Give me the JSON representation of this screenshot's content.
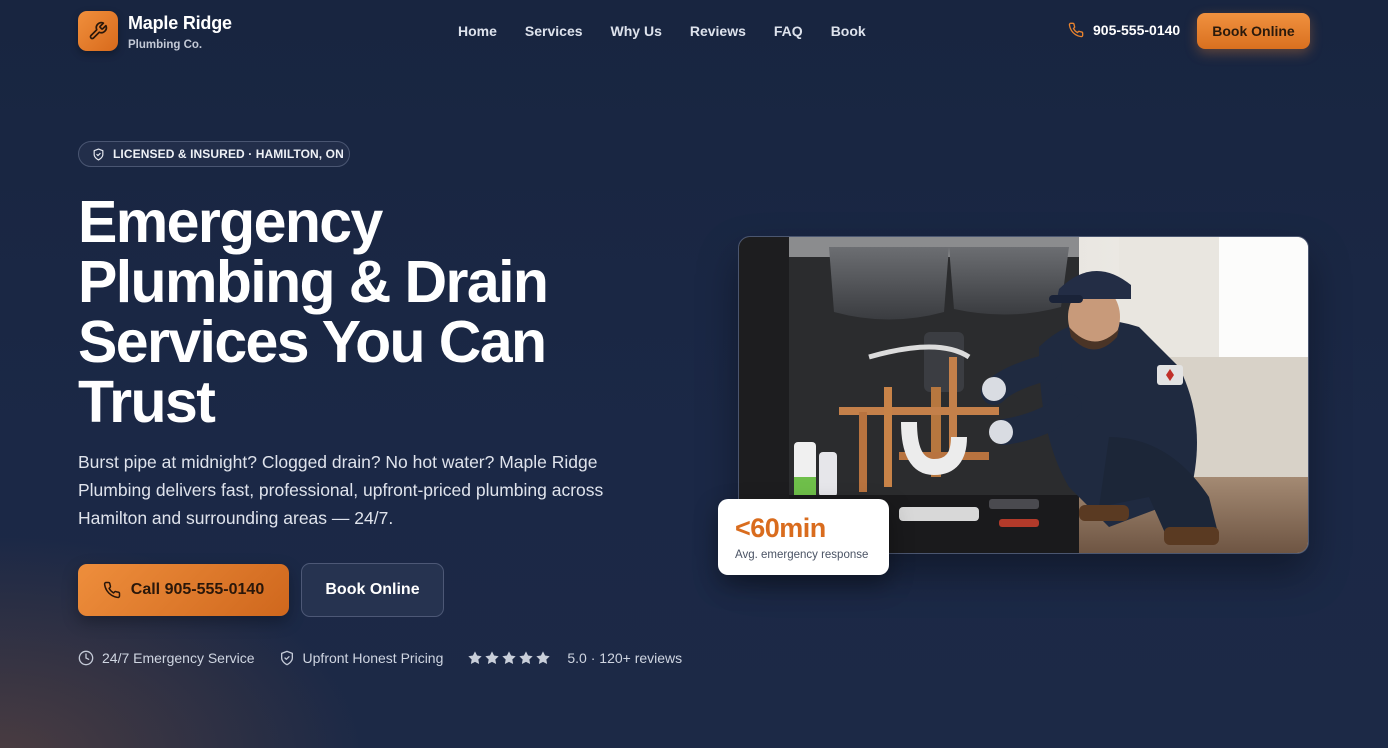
{
  "brand": {
    "name": "Maple Ridge",
    "subtitle": "Plumbing Co.",
    "icon": "wrench-icon",
    "accent": "#e8832e"
  },
  "nav": {
    "links": [
      "Home",
      "Services",
      "Why Us",
      "Reviews",
      "FAQ",
      "Book"
    ],
    "phone": "905-555-0140",
    "cta": "Book Online"
  },
  "hero": {
    "badge": "LICENSED & INSURED · HAMILTON, ON",
    "headline": "Emergency Plumbing & Drain Services You Can Trust",
    "subtext": "Burst pipe at midnight? Clogged drain? No hot water? Maple Ridge Plumbing delivers fast, professional, upfront-priced plumbing across Hamilton and surrounding areas — 24/7.",
    "call_button": "Call 905-555-0140",
    "book_button": "Book Online"
  },
  "trust": {
    "emergency": "24/7 Emergency Service",
    "pricing": "Upfront Honest Pricing",
    "rating_text": "5.0 · 120+ reviews",
    "stars": 5
  },
  "stat": {
    "value": "<60min",
    "label": "Avg. emergency response"
  },
  "colors": {
    "background": "#1b2846",
    "accent": "#e8832e",
    "stat_value": "#d96c1e"
  }
}
